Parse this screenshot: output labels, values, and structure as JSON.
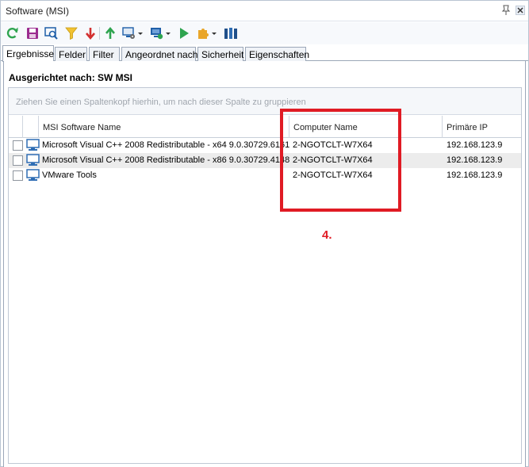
{
  "window": {
    "title": "Software (MSI)"
  },
  "toolbar": {
    "buttons": [
      "refresh-icon",
      "save-icon",
      "search-icon",
      "filter-icon",
      "sort-down-icon",
      "sort-up-icon",
      "computer-settings-icon",
      "computer-refresh-icon",
      "run-icon",
      "puzzle-icon",
      "columns-icon"
    ]
  },
  "tabs": [
    {
      "label": "Ergebnisse",
      "active": true
    },
    {
      "label": "Felder",
      "active": false
    },
    {
      "label": "Filter",
      "active": false
    },
    {
      "label": "Angeordnet nach",
      "active": false
    },
    {
      "label": "Sicherheit",
      "active": false
    },
    {
      "label": "Eigenschaften",
      "active": false
    }
  ],
  "content": {
    "heading": "Ausgerichtet nach: SW MSI",
    "group_hint": "Ziehen Sie einen Spaltenkopf hierhin, um nach dieser Spalte zu gruppieren"
  },
  "table": {
    "columns": [
      "MSI Software Name",
      "Computer Name",
      "Primäre IP"
    ],
    "rows": [
      {
        "name": "Microsoft Visual C++ 2008 Redistributable - x64 9.0.30729.6161",
        "computer": "2-NGOTCLT-W7X64",
        "ip": "192.168.123.9"
      },
      {
        "name": "Microsoft Visual C++ 2008 Redistributable - x86 9.0.30729.4148",
        "computer": "2-NGOTCLT-W7X64",
        "ip": "192.168.123.9"
      },
      {
        "name": "VMware Tools",
        "computer": "2-NGOTCLT-W7X64",
        "ip": "192.168.123.9"
      }
    ]
  },
  "annotation": {
    "label": "4.",
    "color": "#e01b24"
  },
  "colors": {
    "accent_green": "#2ea44f",
    "accent_blue": "#1f5fa8",
    "annotation_red": "#e01b24"
  }
}
